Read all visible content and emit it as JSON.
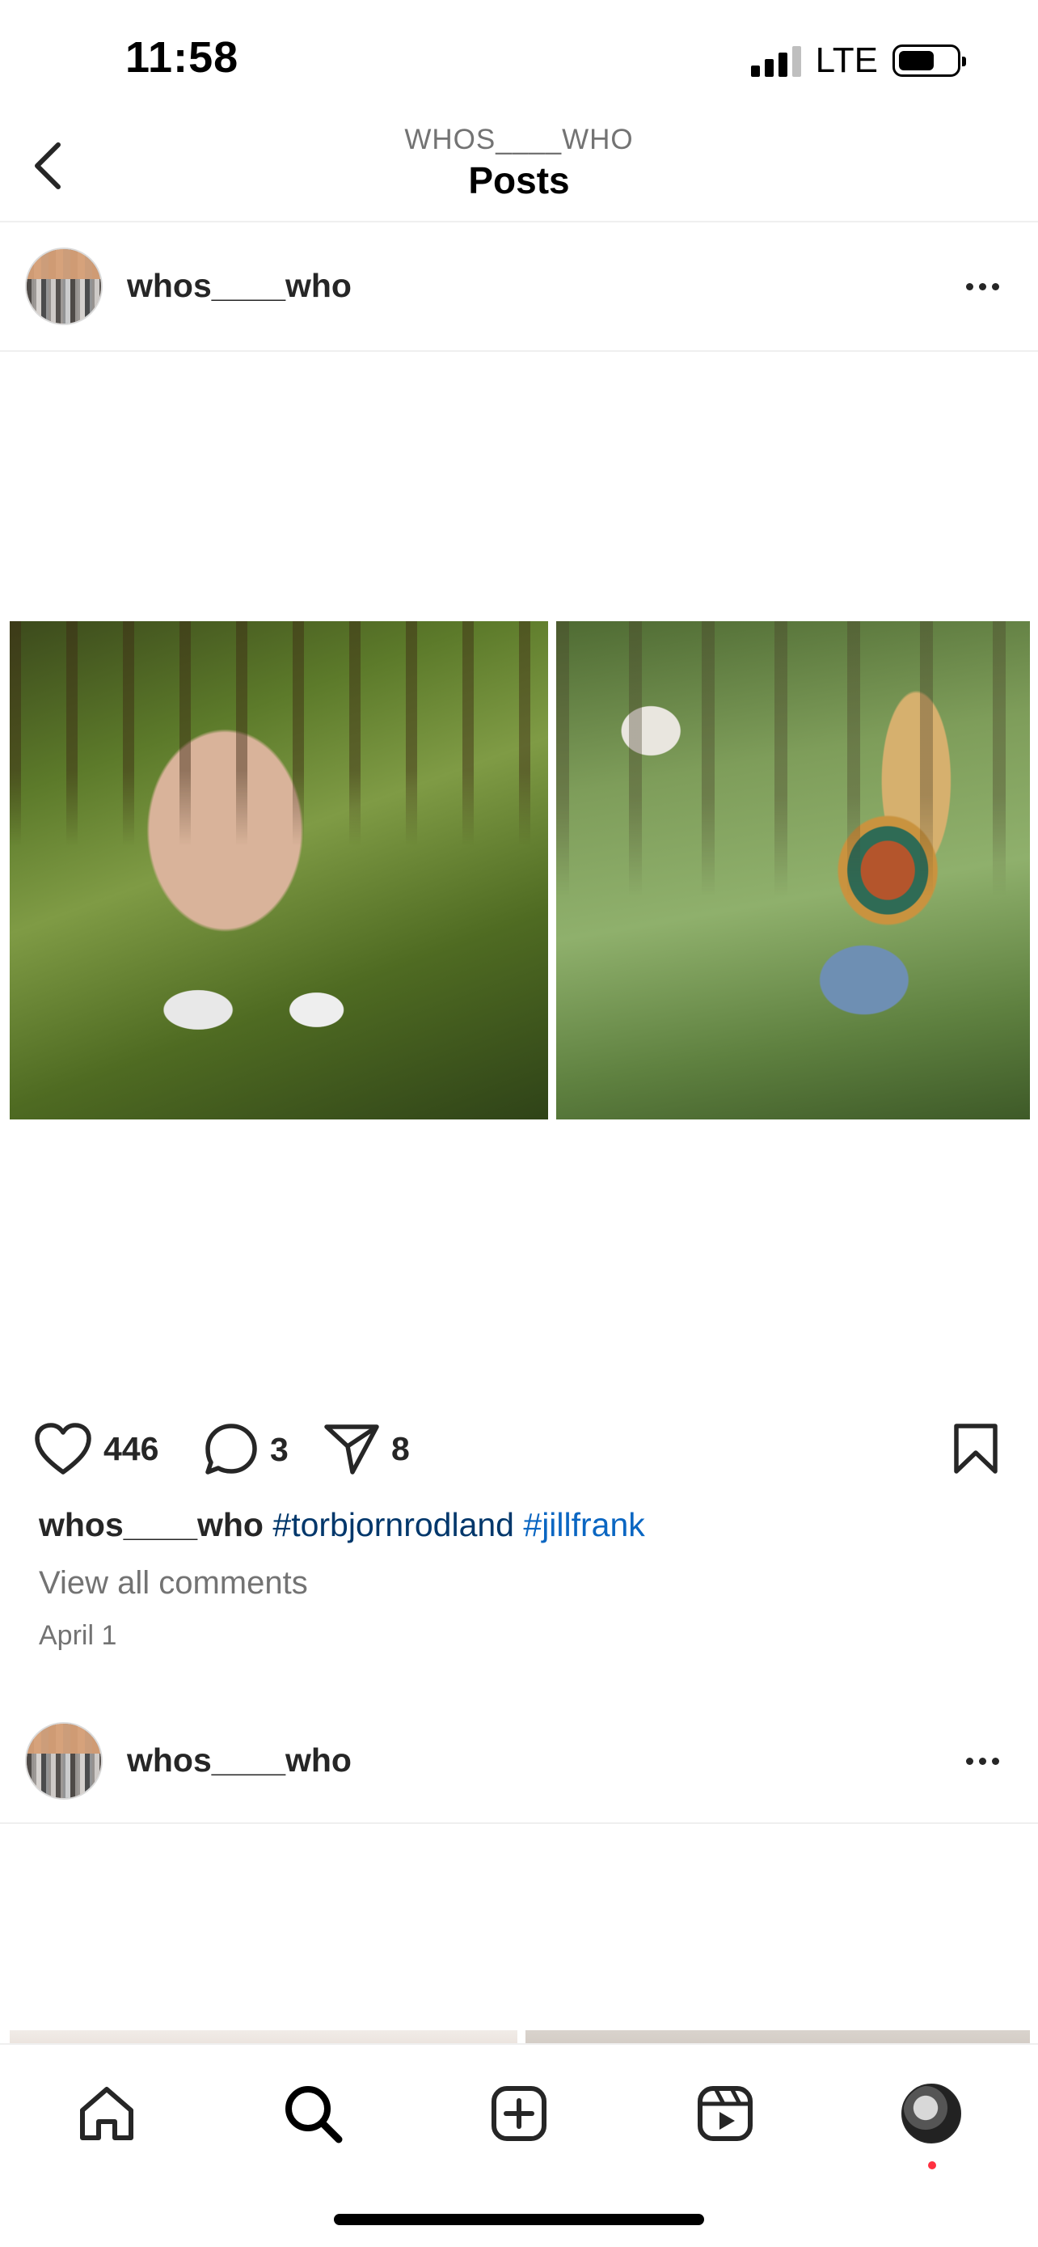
{
  "status_bar": {
    "time": "11:58",
    "network": "LTE",
    "battery_level": 0.55,
    "signal_bars_active": 3,
    "signal_bars_total": 4
  },
  "header": {
    "subtitle": "WHOS____WHO",
    "title": "Posts"
  },
  "post1": {
    "username": "whos____who",
    "likes": "446",
    "comments": "3",
    "shares": "8",
    "caption_user": "whos____who",
    "hashtags": [
      "#torbjornrodland",
      "#jillfrank"
    ],
    "view_comments": "View all comments",
    "date": "April 1"
  },
  "post2": {
    "username": "whos____who"
  },
  "icons": {
    "back": "chevron-left-icon",
    "more": "more-horizontal-icon",
    "like": "heart-icon",
    "comment": "comment-bubble-icon",
    "share": "paper-plane-icon",
    "save": "bookmark-icon",
    "home": "home-icon",
    "search": "search-icon",
    "create": "plus-square-icon",
    "reels": "reels-icon"
  },
  "colors": {
    "hashtag": "#00376b",
    "notification_dot": "#ff3040",
    "secondary_text": "#737373"
  }
}
